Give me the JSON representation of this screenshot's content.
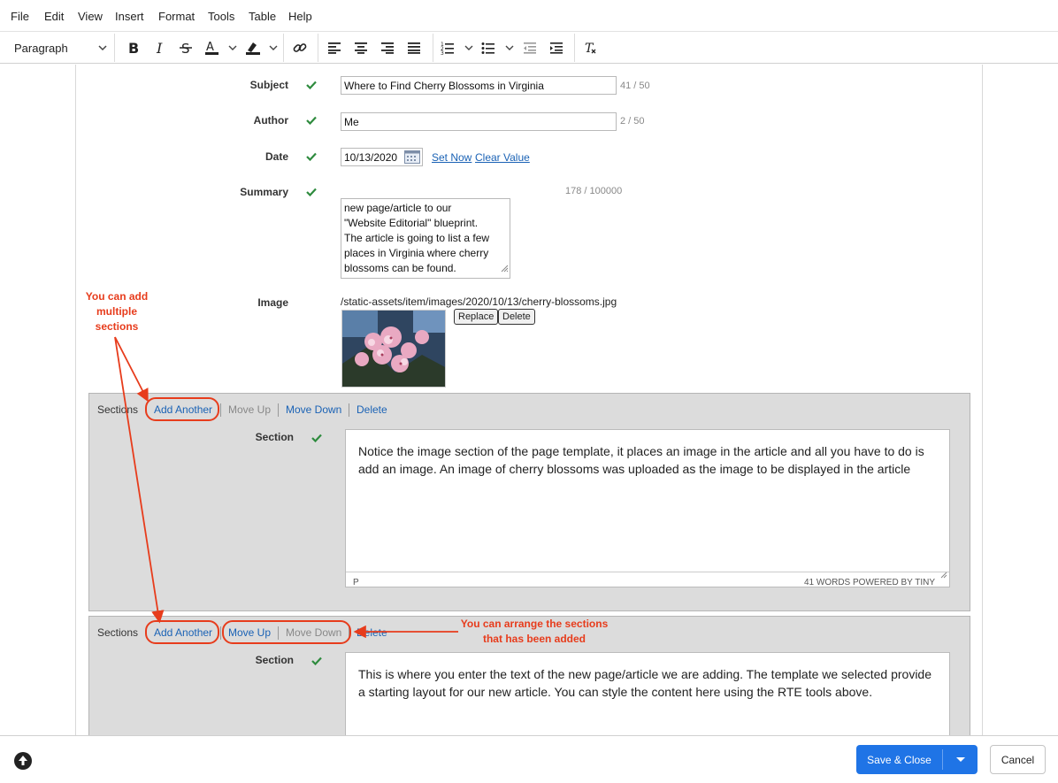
{
  "menubar": {
    "items": [
      "File",
      "Edit",
      "View",
      "Insert",
      "Format",
      "Tools",
      "Table",
      "Help"
    ]
  },
  "toolbar": {
    "block_format": "Paragraph",
    "icons": [
      "bold-icon",
      "italic-icon",
      "strikethrough-icon",
      "text-color-icon",
      "highlight-icon",
      "link-icon",
      "align-left-icon",
      "align-center-icon",
      "align-right-icon",
      "align-justify-icon",
      "numbered-list-icon",
      "bullet-list-icon",
      "outdent-icon",
      "indent-icon",
      "clear-formatting-icon"
    ]
  },
  "form": {
    "subject": {
      "label": "Subject",
      "value": "Where to Find Cherry Blossoms in Virginia",
      "count": "41 / 50"
    },
    "author": {
      "label": "Author",
      "value": "Me",
      "count": "2 / 50"
    },
    "date": {
      "label": "Date",
      "value": "10/13/2020",
      "set_now": "Set Now",
      "clear_value": "Clear Value"
    },
    "summary": {
      "label": "Summary",
      "count": "178 / 100000",
      "lines": [
        "new page/article to our",
        "\"Website Editorial\" blueprint.",
        "The article is going to list a few",
        "places in Virginia where cherry",
        "blossoms can be found."
      ]
    },
    "image": {
      "label": "Image",
      "path": "/static-assets/item/images/2020/10/13/cherry-blossoms.jpg",
      "replace": "Replace",
      "delete": "Delete"
    }
  },
  "sections": [
    {
      "title": "Sections",
      "add_another": "Add Another",
      "move_up": "Move Up",
      "move_down": "Move Down",
      "delete": "Delete",
      "field_label": "Section",
      "text": "Notice the image section of the page template, it places an image in the article and all you have to do is add an image.  An image of cherry blossoms was uploaded as the image  to be displayed in the article",
      "status_left": "P",
      "status_right": "41 WORDS  POWERED BY TINY"
    },
    {
      "title": "Sections",
      "add_another": "Add Another",
      "move_up": "Move Up",
      "move_down": "Move Down",
      "delete": "Delete",
      "field_label": "Section",
      "text": "This is where you enter the text of the new page/article we are adding.  The template we selected provide a starting layout for our new article.  You can style  the content here using the RTE tools above."
    }
  ],
  "annotations": {
    "add_sections": [
      "You can add",
      "multiple",
      "sections"
    ],
    "arrange": [
      "You can arrange the sections",
      "that has been added"
    ]
  },
  "footer": {
    "save_close": "Save & Close",
    "cancel": "Cancel"
  },
  "colors": {
    "accent": "#1a62b5",
    "primary_button": "#1f74e6",
    "annotation": "#e73c1c",
    "check": "#2e8b3e"
  }
}
